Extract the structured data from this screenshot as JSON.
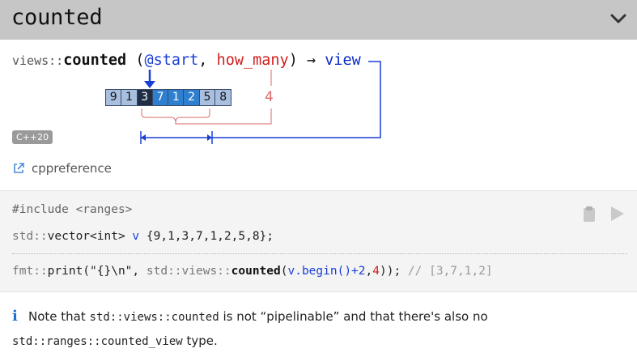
{
  "header": {
    "title": "counted",
    "collapse_icon": "chevron-down-icon"
  },
  "signature": {
    "namespace": "views::",
    "function": "counted",
    "open": " (",
    "param_start": "@start",
    "comma": ", ",
    "param_count": "how_many",
    "close": ") ",
    "arrow": "→",
    "return_label": "view"
  },
  "diagram": {
    "cells": [
      "9",
      "1",
      "3",
      "7",
      "1",
      "2",
      "5",
      "8"
    ],
    "start_index": 2,
    "count": 4,
    "count_label": "4",
    "colors": {
      "start": "#1f2e45",
      "selected": "#2e7fcf",
      "plain": "#a9bfe0",
      "accent_blue": "#1a3fd6",
      "accent_red": "#d96a6a"
    }
  },
  "badge": "C++20",
  "link": {
    "label": "cppreference",
    "icon": "external-link-icon"
  },
  "code": {
    "line1": "#include <ranges>",
    "line2": {
      "ns": "std::",
      "type": "vector<int> ",
      "var": "v",
      "rest": " {9,1,3,7,1,2,5,8};"
    },
    "line3": {
      "ns1": "fmt::",
      "call1": "print(\"{}\\n\", ",
      "ns2": "std::views::",
      "fn": "counted",
      "open": "(",
      "arg1": "v.begin()+2",
      "comma": ",",
      "arg2": "4",
      "close": ")); ",
      "comment": "// [3,7,1,2]"
    },
    "buttons": {
      "copy": "clipboard-icon",
      "run": "play-icon"
    }
  },
  "note": {
    "icon": "info-icon",
    "text1": "Note that ",
    "code1": "std::views::counted",
    "text2": " is not “pipelinable” and that there's also no",
    "code2": "std::ranges::counted_view",
    "text3": " type."
  }
}
